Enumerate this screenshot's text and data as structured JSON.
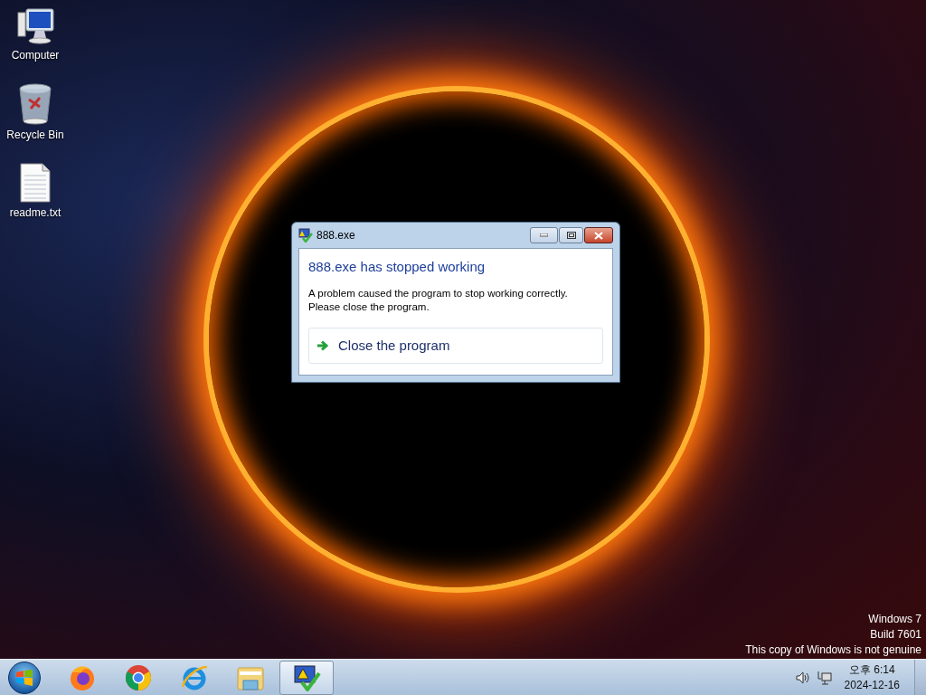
{
  "desktop": {
    "icons": [
      {
        "kind": "computer",
        "label": "Computer"
      },
      {
        "kind": "recycle-bin",
        "label": "Recycle Bin"
      },
      {
        "kind": "text-file",
        "label": "readme.txt"
      }
    ]
  },
  "dialog": {
    "title": "888.exe",
    "heading": "888.exe has stopped working",
    "message": "A problem caused the program to stop working correctly.\nPlease close the program.",
    "action": "Close the program"
  },
  "genuine_notice": [
    "Windows 7",
    "Build 7601",
    "This copy of Windows is not genuine"
  ],
  "taskbar": {
    "buttons": [
      {
        "kind": "firefox",
        "selected": false
      },
      {
        "kind": "chrome",
        "selected": false
      },
      {
        "kind": "ie",
        "selected": false
      },
      {
        "kind": "explorer",
        "selected": false
      },
      {
        "kind": "error-report",
        "selected": true
      }
    ],
    "clock": {
      "time": "오후 6:14",
      "date": "2024-12-16"
    }
  }
}
